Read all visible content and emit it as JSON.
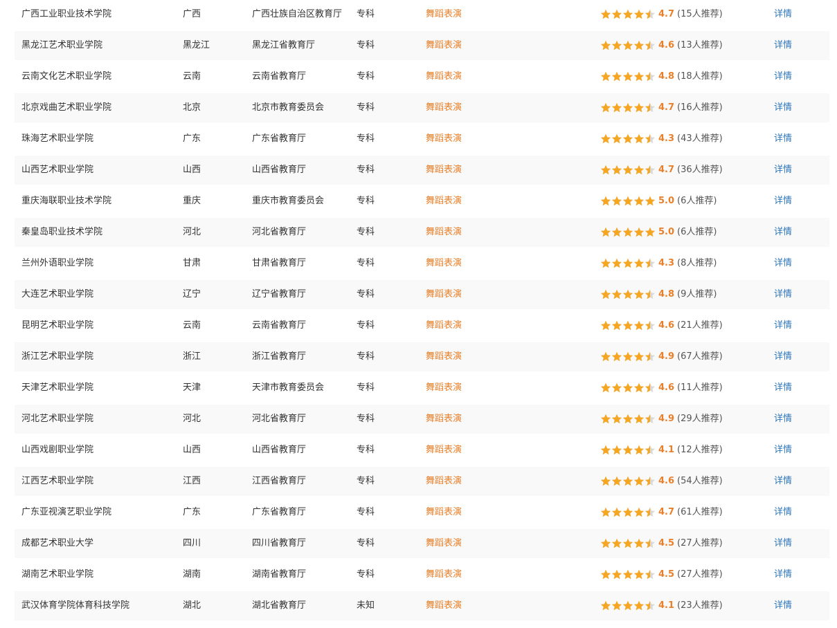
{
  "colors": {
    "accent_orange": "#e8802b",
    "star_orange": "#f5a623",
    "star_empty": "#d9d9d9",
    "link_blue": "#2d76b8",
    "row_alt": "#f9f9f9"
  },
  "icons": {
    "rating_star": "star-icon"
  },
  "rows": [
    {
      "name": "广西工业职业技术学院",
      "province": "广西",
      "authority": "广西壮族自治区教育厅",
      "level": "专科",
      "major": "舞蹈表演",
      "rating": "4.7",
      "stars": 4.5,
      "count": "(15人推荐)",
      "detail": "详情"
    },
    {
      "name": "黑龙江艺术职业学院",
      "province": "黑龙江",
      "authority": "黑龙江省教育厅",
      "level": "专科",
      "major": "舞蹈表演",
      "rating": "4.6",
      "stars": 4.5,
      "count": "(13人推荐)",
      "detail": "详情"
    },
    {
      "name": "云南文化艺术职业学院",
      "province": "云南",
      "authority": "云南省教育厅",
      "level": "专科",
      "major": "舞蹈表演",
      "rating": "4.8",
      "stars": 4.5,
      "count": "(18人推荐)",
      "detail": "详情"
    },
    {
      "name": "北京戏曲艺术职业学院",
      "province": "北京",
      "authority": "北京市教育委员会",
      "level": "专科",
      "major": "舞蹈表演",
      "rating": "4.7",
      "stars": 4.5,
      "count": "(16人推荐)",
      "detail": "详情"
    },
    {
      "name": "珠海艺术职业学院",
      "province": "广东",
      "authority": "广东省教育厅",
      "level": "专科",
      "major": "舞蹈表演",
      "rating": "4.3",
      "stars": 4.5,
      "count": "(43人推荐)",
      "detail": "详情"
    },
    {
      "name": "山西艺术职业学院",
      "province": "山西",
      "authority": "山西省教育厅",
      "level": "专科",
      "major": "舞蹈表演",
      "rating": "4.7",
      "stars": 4.5,
      "count": "(36人推荐)",
      "detail": "详情"
    },
    {
      "name": "重庆海联职业技术学院",
      "province": "重庆",
      "authority": "重庆市教育委员会",
      "level": "专科",
      "major": "舞蹈表演",
      "rating": "5.0",
      "stars": 5,
      "count": "(6人推荐)",
      "detail": "详情"
    },
    {
      "name": "秦皇岛职业技术学院",
      "province": "河北",
      "authority": "河北省教育厅",
      "level": "专科",
      "major": "舞蹈表演",
      "rating": "5.0",
      "stars": 5,
      "count": "(6人推荐)",
      "detail": "详情"
    },
    {
      "name": "兰州外语职业学院",
      "province": "甘肃",
      "authority": "甘肃省教育厅",
      "level": "专科",
      "major": "舞蹈表演",
      "rating": "4.3",
      "stars": 4.5,
      "count": "(8人推荐)",
      "detail": "详情"
    },
    {
      "name": "大连艺术职业学院",
      "province": "辽宁",
      "authority": "辽宁省教育厅",
      "level": "专科",
      "major": "舞蹈表演",
      "rating": "4.8",
      "stars": 4.5,
      "count": "(9人推荐)",
      "detail": "详情"
    },
    {
      "name": "昆明艺术职业学院",
      "province": "云南",
      "authority": "云南省教育厅",
      "level": "专科",
      "major": "舞蹈表演",
      "rating": "4.6",
      "stars": 4.5,
      "count": "(21人推荐)",
      "detail": "详情"
    },
    {
      "name": "浙江艺术职业学院",
      "province": "浙江",
      "authority": "浙江省教育厅",
      "level": "专科",
      "major": "舞蹈表演",
      "rating": "4.9",
      "stars": 4.5,
      "count": "(67人推荐)",
      "detail": "详情"
    },
    {
      "name": "天津艺术职业学院",
      "province": "天津",
      "authority": "天津市教育委员会",
      "level": "专科",
      "major": "舞蹈表演",
      "rating": "4.6",
      "stars": 4.5,
      "count": "(11人推荐)",
      "detail": "详情"
    },
    {
      "name": "河北艺术职业学院",
      "province": "河北",
      "authority": "河北省教育厅",
      "level": "专科",
      "major": "舞蹈表演",
      "rating": "4.9",
      "stars": 4.5,
      "count": "(29人推荐)",
      "detail": "详情"
    },
    {
      "name": "山西戏剧职业学院",
      "province": "山西",
      "authority": "山西省教育厅",
      "level": "专科",
      "major": "舞蹈表演",
      "rating": "4.1",
      "stars": 4.5,
      "count": "(12人推荐)",
      "detail": "详情"
    },
    {
      "name": "江西艺术职业学院",
      "province": "江西",
      "authority": "江西省教育厅",
      "level": "专科",
      "major": "舞蹈表演",
      "rating": "4.6",
      "stars": 4.5,
      "count": "(54人推荐)",
      "detail": "详情"
    },
    {
      "name": "广东亚视演艺职业学院",
      "province": "广东",
      "authority": "广东省教育厅",
      "level": "专科",
      "major": "舞蹈表演",
      "rating": "4.7",
      "stars": 4.5,
      "count": "(61人推荐)",
      "detail": "详情"
    },
    {
      "name": "成都艺术职业大学",
      "province": "四川",
      "authority": "四川省教育厅",
      "level": "专科",
      "major": "舞蹈表演",
      "rating": "4.5",
      "stars": 4.5,
      "count": "(27人推荐)",
      "detail": "详情"
    },
    {
      "name": "湖南艺术职业学院",
      "province": "湖南",
      "authority": "湖南省教育厅",
      "level": "专科",
      "major": "舞蹈表演",
      "rating": "4.5",
      "stars": 4.5,
      "count": "(27人推荐)",
      "detail": "详情"
    },
    {
      "name": "武汉体育学院体育科技学院",
      "province": "湖北",
      "authority": "湖北省教育厅",
      "level": "未知",
      "major": "舞蹈表演",
      "rating": "4.1",
      "stars": 4.5,
      "count": "(23人推荐)",
      "detail": "详情"
    }
  ]
}
